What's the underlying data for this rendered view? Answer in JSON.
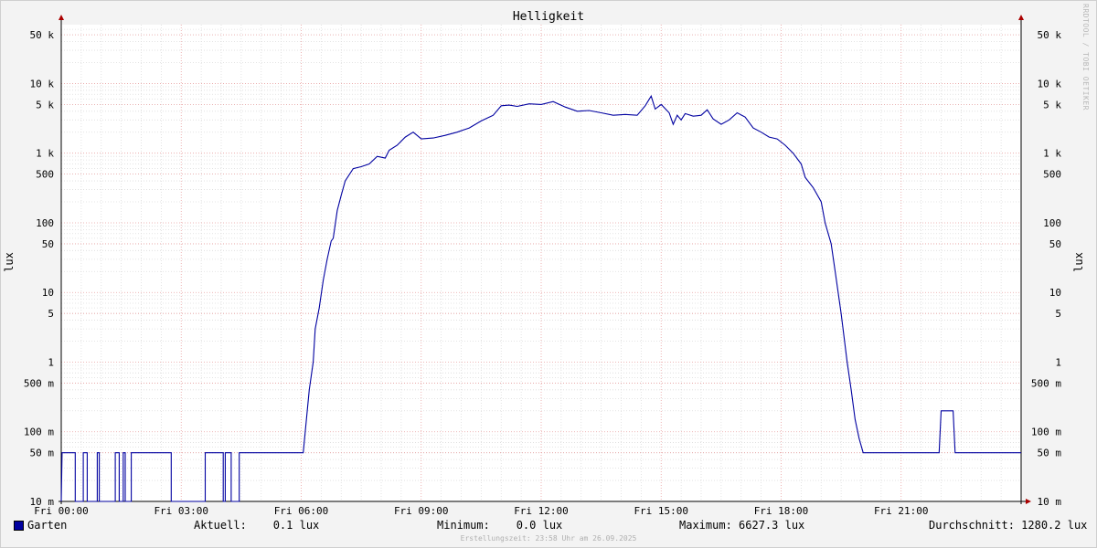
{
  "chart_data": {
    "type": "line",
    "title": "Helligkeit",
    "ylabel": "lux",
    "yscale": "log",
    "ylim": [
      0.01,
      70000
    ],
    "xlim": [
      0,
      24
    ],
    "x_ticks": [
      "Fri 00:00",
      "Fri 03:00",
      "Fri 06:00",
      "Fri 09:00",
      "Fri 12:00",
      "Fri 15:00",
      "Fri 18:00",
      "Fri 21:00"
    ],
    "x_tick_values": [
      0,
      3,
      6,
      9,
      12,
      15,
      18,
      21
    ],
    "y_ticks": [
      {
        "v": 50000,
        "label": "50 k"
      },
      {
        "v": 10000,
        "label": "10 k"
      },
      {
        "v": 5000,
        "label": "5 k"
      },
      {
        "v": 1000,
        "label": "1 k"
      },
      {
        "v": 500,
        "label": "500"
      },
      {
        "v": 100,
        "label": "100"
      },
      {
        "v": 50,
        "label": "50"
      },
      {
        "v": 10,
        "label": "10"
      },
      {
        "v": 5,
        "label": "5"
      },
      {
        "v": 1,
        "label": "1"
      },
      {
        "v": 0.5,
        "label": "500 m"
      },
      {
        "v": 0.1,
        "label": "100 m"
      },
      {
        "v": 0.05,
        "label": "50 m"
      },
      {
        "v": 0.01,
        "label": "10 m"
      }
    ],
    "grid": true,
    "series": [
      {
        "name": "Garten",
        "color": "#0000a0",
        "points": [
          [
            0,
            0.01
          ],
          [
            0.02,
            0.05
          ],
          [
            0.35,
            0.05
          ],
          [
            0.35,
            0.01
          ],
          [
            0.55,
            0.01
          ],
          [
            0.55,
            0.05
          ],
          [
            0.65,
            0.05
          ],
          [
            0.65,
            0.01
          ],
          [
            0.9,
            0.01
          ],
          [
            0.9,
            0.05
          ],
          [
            0.95,
            0.05
          ],
          [
            0.95,
            0.01
          ],
          [
            1.35,
            0.01
          ],
          [
            1.35,
            0.05
          ],
          [
            1.45,
            0.05
          ],
          [
            1.45,
            0.01
          ],
          [
            1.55,
            0.01
          ],
          [
            1.55,
            0.05
          ],
          [
            1.6,
            0.05
          ],
          [
            1.6,
            0.01
          ],
          [
            1.75,
            0.01
          ],
          [
            1.75,
            0.05
          ],
          [
            2.75,
            0.05
          ],
          [
            2.75,
            0.01
          ],
          [
            3.6,
            0.01
          ],
          [
            3.6,
            0.05
          ],
          [
            4.05,
            0.05
          ],
          [
            4.05,
            0.01
          ],
          [
            4.1,
            0.01
          ],
          [
            4.1,
            0.05
          ],
          [
            4.25,
            0.05
          ],
          [
            4.25,
            0.01
          ],
          [
            4.45,
            0.01
          ],
          [
            4.45,
            0.05
          ],
          [
            6.05,
            0.05
          ],
          [
            6.05,
            0.05
          ],
          [
            6.1,
            0.1
          ],
          [
            6.2,
            0.4
          ],
          [
            6.3,
            1.0
          ],
          [
            6.35,
            3
          ],
          [
            6.45,
            6
          ],
          [
            6.55,
            15
          ],
          [
            6.65,
            30
          ],
          [
            6.75,
            55
          ],
          [
            6.8,
            60
          ],
          [
            6.9,
            150
          ],
          [
            7.0,
            250
          ],
          [
            7.1,
            400
          ],
          [
            7.3,
            600
          ],
          [
            7.5,
            640
          ],
          [
            7.7,
            700
          ],
          [
            7.9,
            900
          ],
          [
            8.1,
            850
          ],
          [
            8.2,
            1100
          ],
          [
            8.4,
            1300
          ],
          [
            8.6,
            1700
          ],
          [
            8.8,
            2000
          ],
          [
            9.0,
            1600
          ],
          [
            9.3,
            1650
          ],
          [
            9.6,
            1800
          ],
          [
            9.9,
            2000
          ],
          [
            10.2,
            2300
          ],
          [
            10.5,
            2900
          ],
          [
            10.8,
            3500
          ],
          [
            11.0,
            4800
          ],
          [
            11.2,
            4900
          ],
          [
            11.4,
            4700
          ],
          [
            11.7,
            5100
          ],
          [
            12.0,
            5000
          ],
          [
            12.3,
            5500
          ],
          [
            12.6,
            4600
          ],
          [
            12.9,
            4000
          ],
          [
            13.2,
            4100
          ],
          [
            13.5,
            3800
          ],
          [
            13.8,
            3500
          ],
          [
            14.1,
            3600
          ],
          [
            14.4,
            3500
          ],
          [
            14.6,
            4800
          ],
          [
            14.75,
            6600
          ],
          [
            14.85,
            4300
          ],
          [
            15.0,
            5000
          ],
          [
            15.2,
            3800
          ],
          [
            15.3,
            2600
          ],
          [
            15.4,
            3500
          ],
          [
            15.5,
            3000
          ],
          [
            15.6,
            3700
          ],
          [
            15.8,
            3400
          ],
          [
            16.0,
            3500
          ],
          [
            16.15,
            4200
          ],
          [
            16.3,
            3100
          ],
          [
            16.5,
            2600
          ],
          [
            16.7,
            3000
          ],
          [
            16.9,
            3800
          ],
          [
            17.1,
            3300
          ],
          [
            17.3,
            2300
          ],
          [
            17.5,
            2000
          ],
          [
            17.7,
            1700
          ],
          [
            17.9,
            1600
          ],
          [
            18.1,
            1300
          ],
          [
            18.3,
            1000
          ],
          [
            18.5,
            700
          ],
          [
            18.6,
            450
          ],
          [
            18.8,
            320
          ],
          [
            19.0,
            200
          ],
          [
            19.1,
            100
          ],
          [
            19.25,
            50
          ],
          [
            19.35,
            20
          ],
          [
            19.5,
            5
          ],
          [
            19.65,
            1.0
          ],
          [
            19.75,
            0.4
          ],
          [
            19.85,
            0.15
          ],
          [
            19.95,
            0.08
          ],
          [
            20.05,
            0.05
          ],
          [
            21.95,
            0.05
          ],
          [
            22.0,
            0.2
          ],
          [
            22.3,
            0.2
          ],
          [
            22.35,
            0.05
          ],
          [
            24,
            0.05
          ]
        ]
      }
    ]
  },
  "legend": {
    "name": "Garten",
    "current": "Aktuell:    0.1 lux",
    "minimum": "Minimum:    0.0 lux",
    "maximum": "Maximum: 6627.3 lux",
    "average": "Durchschnitt: 1280.2 lux"
  },
  "watermark": "RRDTOOL / TOBI OETIKER",
  "footer": "Erstellungszeit: 23:58 Uhr am 26.09.2025"
}
